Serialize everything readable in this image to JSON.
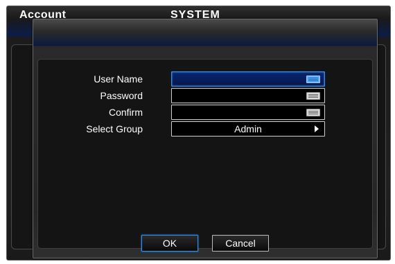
{
  "background": {
    "left_title": "Account",
    "center_title": "SYSTEM"
  },
  "form": {
    "user_name_label": "User Name",
    "user_name_value": "",
    "password_label": "Password",
    "password_value": "",
    "confirm_label": "Confirm",
    "confirm_value": "",
    "select_group_label": "Select Group",
    "select_group_value": "Admin"
  },
  "buttons": {
    "ok": "OK",
    "cancel": "Cancel"
  },
  "colors": {
    "accent": "#2f8ff0",
    "active_field": "#0a2670",
    "dialog_bg": "#262626"
  },
  "icons": {
    "keyboard": "keyboard-icon",
    "arrow": "chevron-right-icon"
  }
}
